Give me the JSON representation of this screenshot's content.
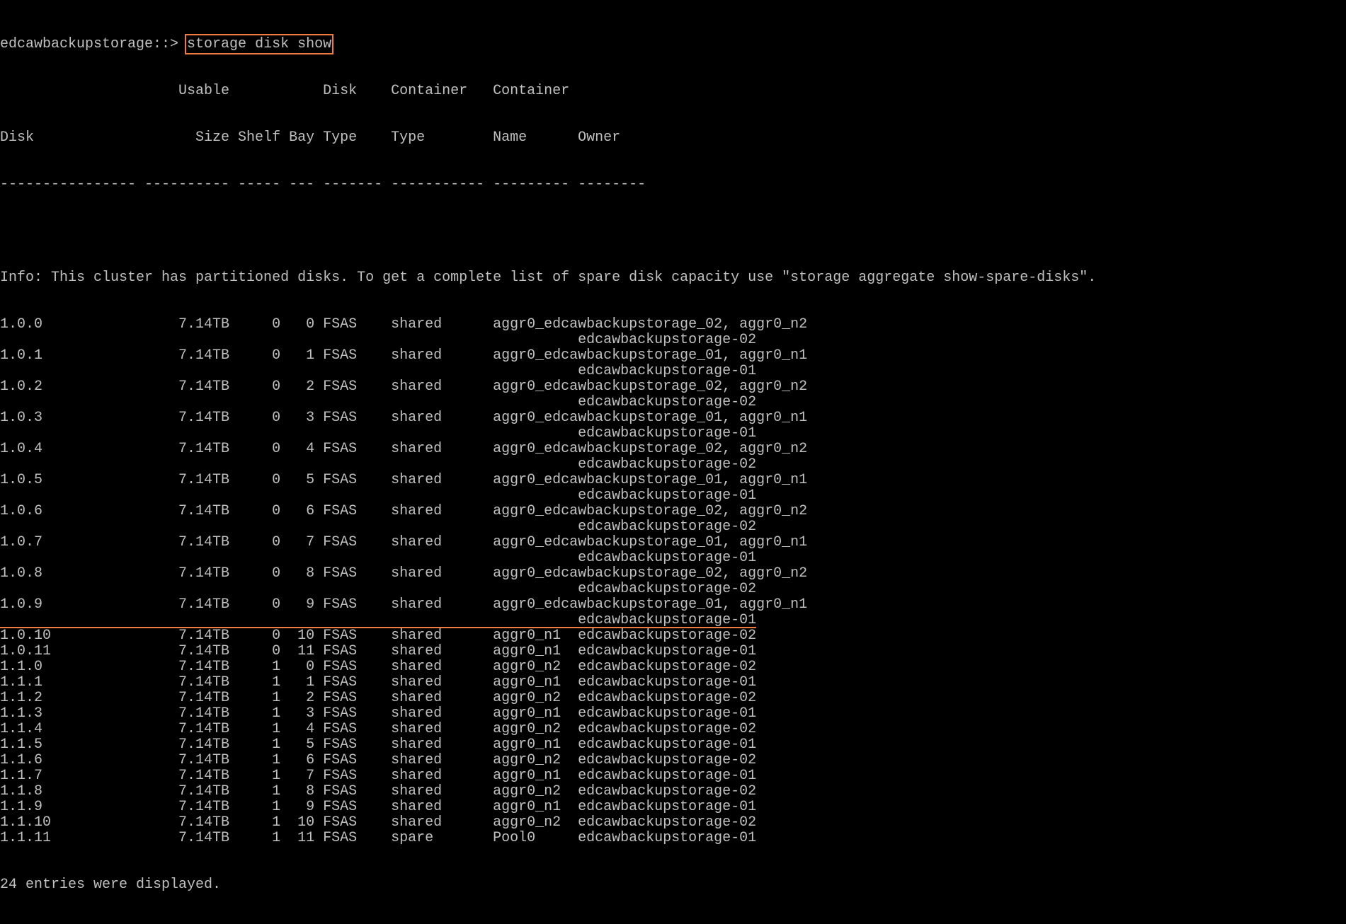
{
  "prompt": "edcawbackupstorage::> ",
  "command": "storage disk show",
  "header_lines": [
    "                     Usable           Disk    Container   Container",
    "Disk                   Size Shelf Bay Type    Type        Name      Owner",
    "---------------- ---------- ----- --- ------- ----------- --------- --------"
  ],
  "blank_line": "",
  "info_line": "Info: This cluster has partitioned disks. To get a complete list of spare disk capacity use \"storage aggregate show-spare-disks\".",
  "rows": [
    "1.0.0                7.14TB     0   0 FSAS    shared      aggr0_edcawbackupstorage_02, aggr0_n2",
    "                                                                    edcawbackupstorage-02",
    "1.0.1                7.14TB     0   1 FSAS    shared      aggr0_edcawbackupstorage_01, aggr0_n1",
    "                                                                    edcawbackupstorage-01",
    "1.0.2                7.14TB     0   2 FSAS    shared      aggr0_edcawbackupstorage_02, aggr0_n2",
    "                                                                    edcawbackupstorage-02",
    "1.0.3                7.14TB     0   3 FSAS    shared      aggr0_edcawbackupstorage_01, aggr0_n1",
    "                                                                    edcawbackupstorage-01",
    "1.0.4                7.14TB     0   4 FSAS    shared      aggr0_edcawbackupstorage_02, aggr0_n2",
    "                                                                    edcawbackupstorage-02",
    "1.0.5                7.14TB     0   5 FSAS    shared      aggr0_edcawbackupstorage_01, aggr0_n1",
    "                                                                    edcawbackupstorage-01",
    "1.0.6                7.14TB     0   6 FSAS    shared      aggr0_edcawbackupstorage_02, aggr0_n2",
    "                                                                    edcawbackupstorage-02",
    "1.0.7                7.14TB     0   7 FSAS    shared      aggr0_edcawbackupstorage_01, aggr0_n1",
    "                                                                    edcawbackupstorage-01",
    "1.0.8                7.14TB     0   8 FSAS    shared      aggr0_edcawbackupstorage_02, aggr0_n2",
    "                                                                    edcawbackupstorage-02",
    "1.0.9                7.14TB     0   9 FSAS    shared      aggr0_edcawbackupstorage_01, aggr0_n1",
    "                                                                    edcawbackupstorage-01",
    "1.0.10               7.14TB     0  10 FSAS    shared      aggr0_n1  edcawbackupstorage-02",
    "1.0.11               7.14TB     0  11 FSAS    shared      aggr0_n1  edcawbackupstorage-01",
    "1.1.0                7.14TB     1   0 FSAS    shared      aggr0_n2  edcawbackupstorage-02",
    "1.1.1                7.14TB     1   1 FSAS    shared      aggr0_n1  edcawbackupstorage-01",
    "1.1.2                7.14TB     1   2 FSAS    shared      aggr0_n2  edcawbackupstorage-02",
    "1.1.3                7.14TB     1   3 FSAS    shared      aggr0_n1  edcawbackupstorage-01",
    "1.1.4                7.14TB     1   4 FSAS    shared      aggr0_n2  edcawbackupstorage-02",
    "1.1.5                7.14TB     1   5 FSAS    shared      aggr0_n1  edcawbackupstorage-01",
    "1.1.6                7.14TB     1   6 FSAS    shared      aggr0_n2  edcawbackupstorage-02",
    "1.1.7                7.14TB     1   7 FSAS    shared      aggr0_n1  edcawbackupstorage-01",
    "1.1.8                7.14TB     1   8 FSAS    shared      aggr0_n2  edcawbackupstorage-02",
    "1.1.9                7.14TB     1   9 FSAS    shared      aggr0_n1  edcawbackupstorage-01",
    "1.1.10               7.14TB     1  10 FSAS    shared      aggr0_n2  edcawbackupstorage-02",
    "1.1.11               7.14TB     1  11 FSAS    spare       Pool0     edcawbackupstorage-01"
  ],
  "footer": "24 entries were displayed.",
  "colors": {
    "background": "#000000",
    "text": "#c0c0c0",
    "highlight": "#f07b3f"
  }
}
